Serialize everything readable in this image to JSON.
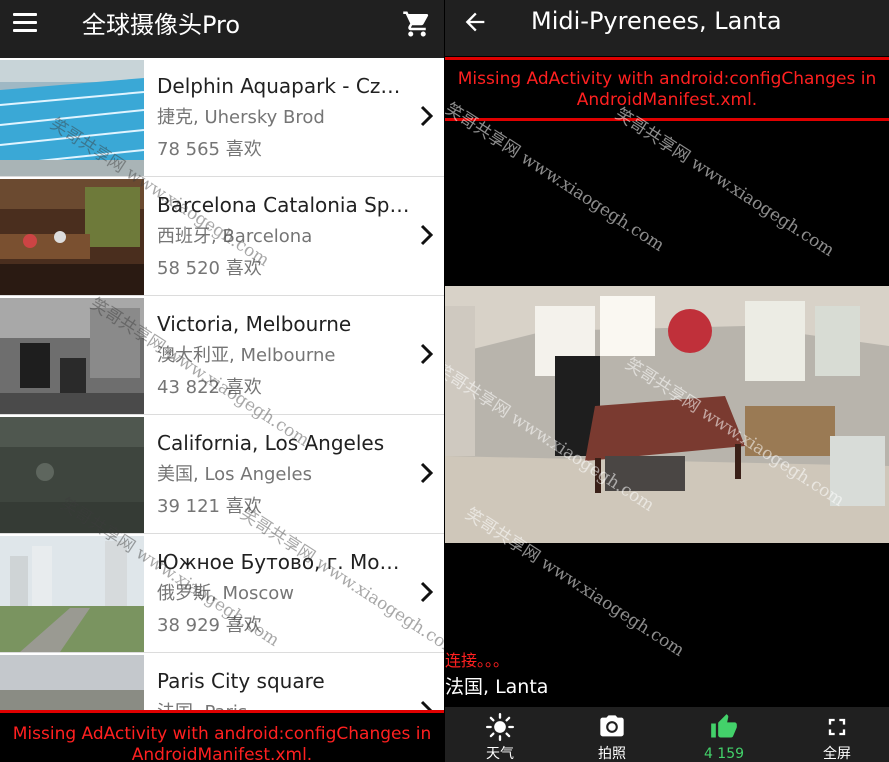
{
  "left": {
    "app_title": "全球摄像头Pro",
    "menu_icon": "menu-icon",
    "cart_icon": "shopping-cart-icon",
    "cameras": [
      {
        "title": "Delphin Aquapark  - Cz…",
        "location": "捷克, Uhersky Brod",
        "likes": "78 565 喜欢"
      },
      {
        "title": "Barcelona Catalonia Sp…",
        "location": "西班牙, Barcelona",
        "likes": "58 520 喜欢"
      },
      {
        "title": "Victoria, Melbourne",
        "location": "澳大利亚, Melbourne",
        "likes": "43 822 喜欢"
      },
      {
        "title": "California, Los Angeles",
        "location": "美国, Los Angeles",
        "likes": "39 121 喜欢"
      },
      {
        "title": "Южное Бутово, г. Мо…",
        "location": "俄罗斯, Moscow",
        "likes": "38 929 喜欢"
      },
      {
        "title": "Paris City square",
        "location": "法国, Paris",
        "likes": ""
      }
    ],
    "ad_text": "Missing AdActivity with android:configChanges in AndroidManifest.xml."
  },
  "right": {
    "camera_title": "Midi-Pyrenees, Lanta",
    "back_icon": "arrow-back-icon",
    "ad_text": "Missing AdActivity with android:configChanges in AndroidManifest.xml.",
    "status": "连接。。。",
    "location": "法国, Lanta",
    "bottom_bar": [
      {
        "label": "天气",
        "icon": "weather-sun-icon"
      },
      {
        "label": "拍照",
        "icon": "camera-icon"
      },
      {
        "label": "4 159",
        "icon": "thumbs-up-icon"
      },
      {
        "label": "全屏",
        "icon": "fullscreen-icon"
      }
    ]
  },
  "watermark": "笑哥共享网 www.xiaogegh.com",
  "colors": {
    "toolbar": "#202020",
    "ad_red": "#ff2020",
    "like_green": "#43d16a"
  }
}
